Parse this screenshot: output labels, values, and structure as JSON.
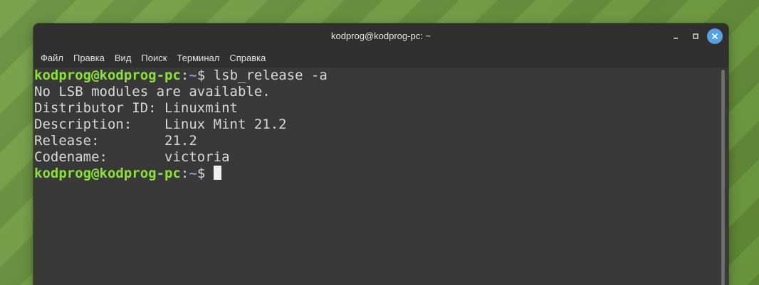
{
  "window": {
    "title": "kodprog@kodprog-pc: ~"
  },
  "menubar": {
    "items": [
      "Файл",
      "Правка",
      "Вид",
      "Поиск",
      "Терминал",
      "Справка"
    ]
  },
  "terminal": {
    "prompt_user_host": "kodprog@kodprog-pc",
    "prompt_sep": ":",
    "prompt_path": "~",
    "prompt_suffix": "$ ",
    "command": "lsb_release -a",
    "output": [
      "No LSB modules are available.",
      "Distributor ID: Linuxmint",
      "Description:    Linux Mint 21.2",
      "Release:        21.2",
      "Codename:       victoria"
    ]
  },
  "icons": {
    "minimize": "minimize-icon",
    "maximize": "maximize-icon",
    "close": "close-icon"
  },
  "colors": {
    "prompt_user": "#8ae234",
    "prompt_path": "#729fcf",
    "terminal_bg": "#383838",
    "close_button": "#55a1e6"
  }
}
